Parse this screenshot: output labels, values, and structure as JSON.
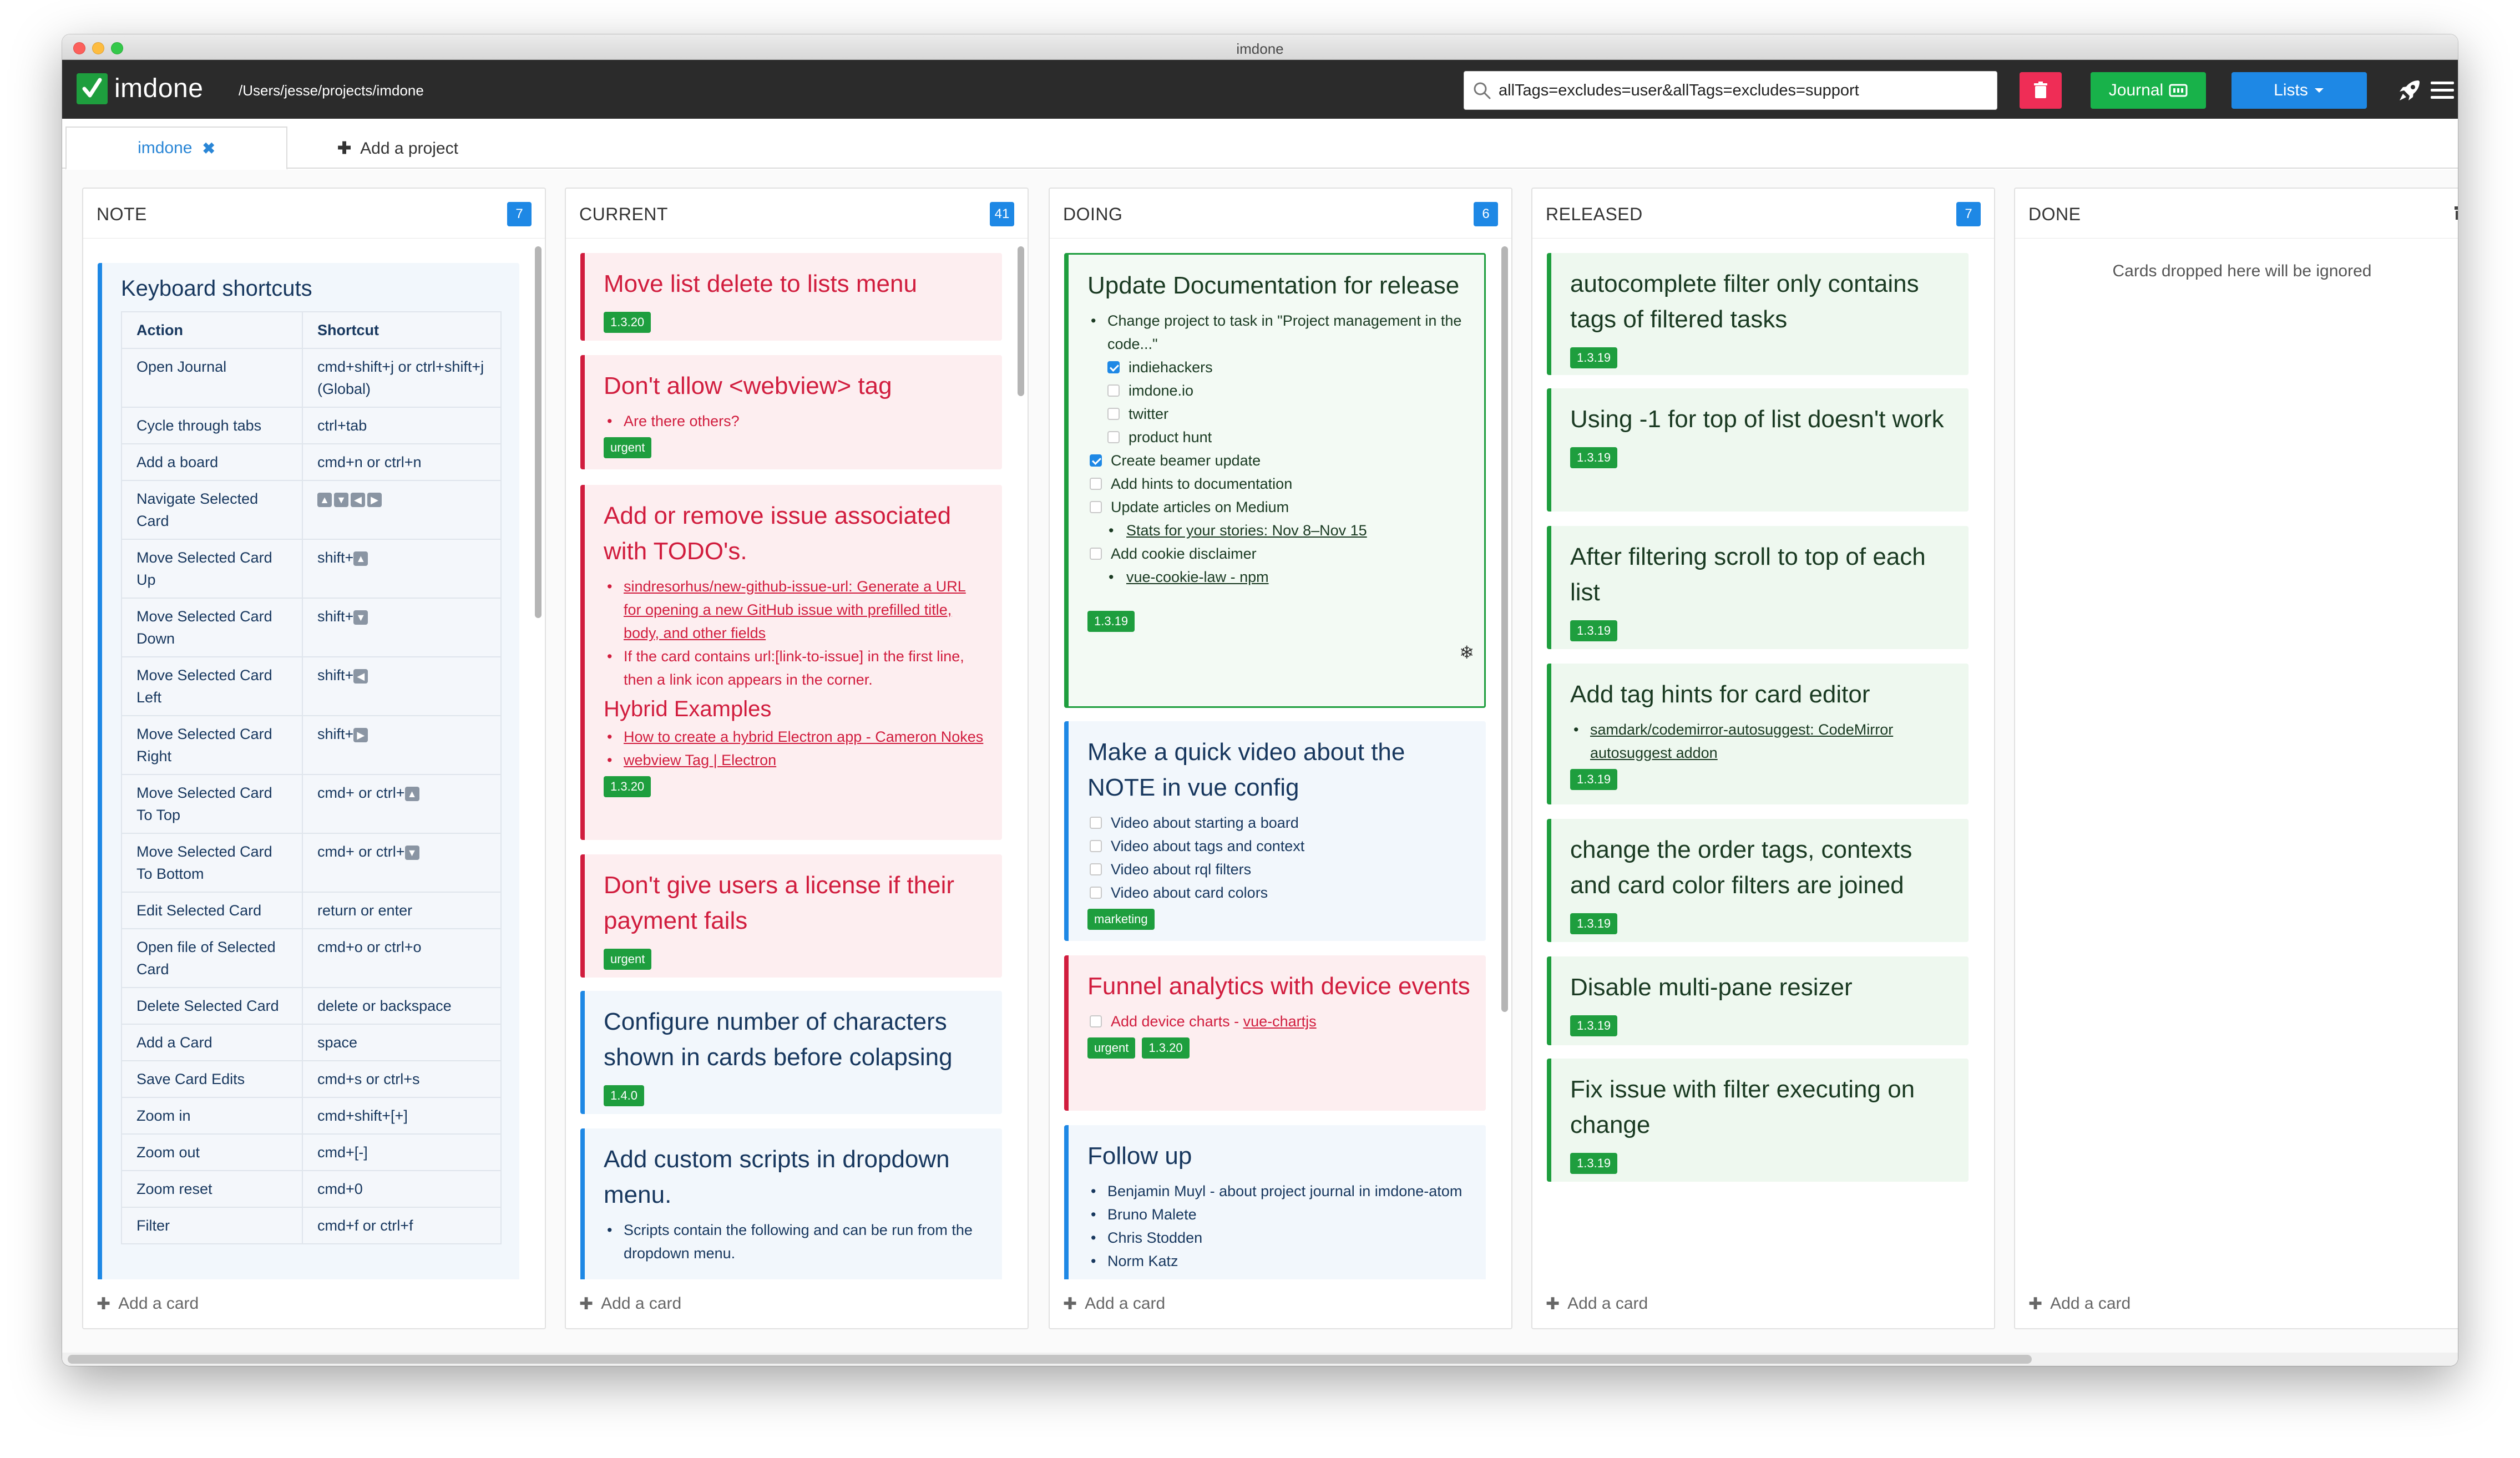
{
  "window": {
    "title": "imdone"
  },
  "app": {
    "logo_text": "imdone",
    "project_path": "/Users/jesse/projects/imdone"
  },
  "search": {
    "value": "allTags=excludes=user&allTags=excludes=support"
  },
  "header_buttons": {
    "journal": "Journal",
    "lists": "Lists"
  },
  "tabs": {
    "active": "imdone",
    "add": "Add a project"
  },
  "add_card_label": "Add a card",
  "lists": [
    {
      "name": "NOTE",
      "count": "7"
    },
    {
      "name": "CURRENT",
      "count": "41"
    },
    {
      "name": "DOING",
      "count": "6"
    },
    {
      "name": "RELEASED",
      "count": "7"
    },
    {
      "name": "DONE",
      "empty_message": "Cards dropped here will be ignored"
    }
  ],
  "note": {
    "title": "Keyboard shortcuts",
    "headers": [
      "Action",
      "Shortcut"
    ],
    "rows": [
      [
        "Open Journal",
        "cmd+shift+j or ctrl+shift+j (Global)"
      ],
      [
        "Cycle through tabs",
        "ctrl+tab"
      ],
      [
        "Add a board",
        "cmd+n or ctrl+n"
      ],
      [
        "Navigate Selected Card",
        ""
      ],
      [
        "Move Selected Card Up",
        "shift+"
      ],
      [
        "Move Selected Card Down",
        "shift+"
      ],
      [
        "Move Selected Card Left",
        "shift+"
      ],
      [
        "Move Selected Card Right",
        "shift+"
      ],
      [
        "Move Selected Card To Top",
        "cmd+ or ctrl+"
      ],
      [
        "Move Selected Card To Bottom",
        "cmd+ or ctrl+"
      ],
      [
        "Edit Selected Card",
        "return or enter"
      ],
      [
        "Open file of Selected Card",
        "cmd+o or ctrl+o"
      ],
      [
        "Delete Selected Card",
        "delete or backspace"
      ],
      [
        "Add a Card",
        "space"
      ],
      [
        "Save Card Edits",
        "cmd+s or ctrl+s"
      ],
      [
        "Zoom in",
        "cmd+shift+[+]"
      ],
      [
        "Zoom out",
        "cmd+[-]"
      ],
      [
        "Zoom reset",
        "cmd+0"
      ],
      [
        "Filter",
        "cmd+f or ctrl+f"
      ]
    ]
  },
  "current": {
    "c1": {
      "title": "Move list delete to lists menu",
      "tag": "1.3.20"
    },
    "c2": {
      "title": "Don't allow <webview> tag",
      "bullet": "Are there others?",
      "tag": "urgent"
    },
    "c3": {
      "title": "Add or remove issue associated with TODO's.",
      "b1": "sindresorhus/new-github-issue-url: Generate a URL for opening a new GitHub issue with prefilled title, body, and other fields",
      "b2": "If the card contains url:[link-to-issue] in the first line, then a link icon appears in the corner.",
      "subhead": "Hybrid Examples",
      "b3": "How to create a hybrid Electron app - Cameron Nokes",
      "b4": "webview Tag | Electron",
      "tag": "1.3.20"
    },
    "c4": {
      "title": "Don't give users a license if their payment fails",
      "tag": "urgent"
    },
    "c5": {
      "title": "Configure number of characters shown in cards before colapsing",
      "tag": "1.4.0"
    },
    "c6": {
      "title": "Add custom scripts in dropdown menu.",
      "bullet": "Scripts contain the following and can be run from the dropdown menu."
    }
  },
  "doing": {
    "c1": {
      "title": "Update Documentation for release",
      "b1": "Change project to task in \"Project management in the code...\"",
      "sub": [
        "indiehackers",
        "imdone.io",
        "twitter",
        "product hunt"
      ],
      "items": [
        "Create beamer update",
        "Add hints to documentation",
        "Update articles on Medium"
      ],
      "link1": "Stats for your stories: Nov 8–Nov 15",
      "item4": "Add cookie disclaimer",
      "link2": "vue-cookie-law - npm",
      "tag": "1.3.19"
    },
    "c2": {
      "title": "Make a quick video about the NOTE in vue config",
      "items": [
        "Video about starting a board",
        "Video about tags and context",
        "Video about rql filters",
        "Video about card colors"
      ],
      "tag": "marketing"
    },
    "c3": {
      "title": "Funnel analytics with device events",
      "item_prefix": "Add device charts - ",
      "item_link": "vue-chartjs",
      "tags": [
        "urgent",
        "1.3.20"
      ]
    },
    "c4": {
      "title": "Follow up",
      "items": [
        "Benjamin Muyl - about project journal in imdone-atom",
        "Bruno Malete",
        "Chris Stodden",
        "Norm Katz"
      ]
    }
  },
  "released": {
    "c1": {
      "title": "autocomplete filter only contains tags of filtered tasks",
      "tag": "1.3.19"
    },
    "c2": {
      "title": "Using -1 for top of list doesn't work",
      "tag": "1.3.19"
    },
    "c3": {
      "title": "After filtering scroll to top of each list",
      "tag": "1.3.19"
    },
    "c4": {
      "title": "Add tag hints for card editor",
      "bullet": "samdark/codemirror-autosuggest: CodeMirror autosuggest addon",
      "tag": "1.3.19"
    },
    "c5": {
      "title": "change the order tags, contexts and card color filters are joined",
      "tag": "1.3.19"
    },
    "c6": {
      "title": "Disable multi-pane resizer",
      "tag": "1.3.19"
    },
    "c7": {
      "title": "Fix issue with filter executing on change",
      "tag": "1.3.19"
    }
  },
  "colors": {
    "accent_blue": "#1e88e5",
    "urgent_red": "#d11d3e",
    "tag_green": "#1e9e3e",
    "header_dark": "#2b2b2b",
    "trash_pink": "#ef2d56"
  }
}
